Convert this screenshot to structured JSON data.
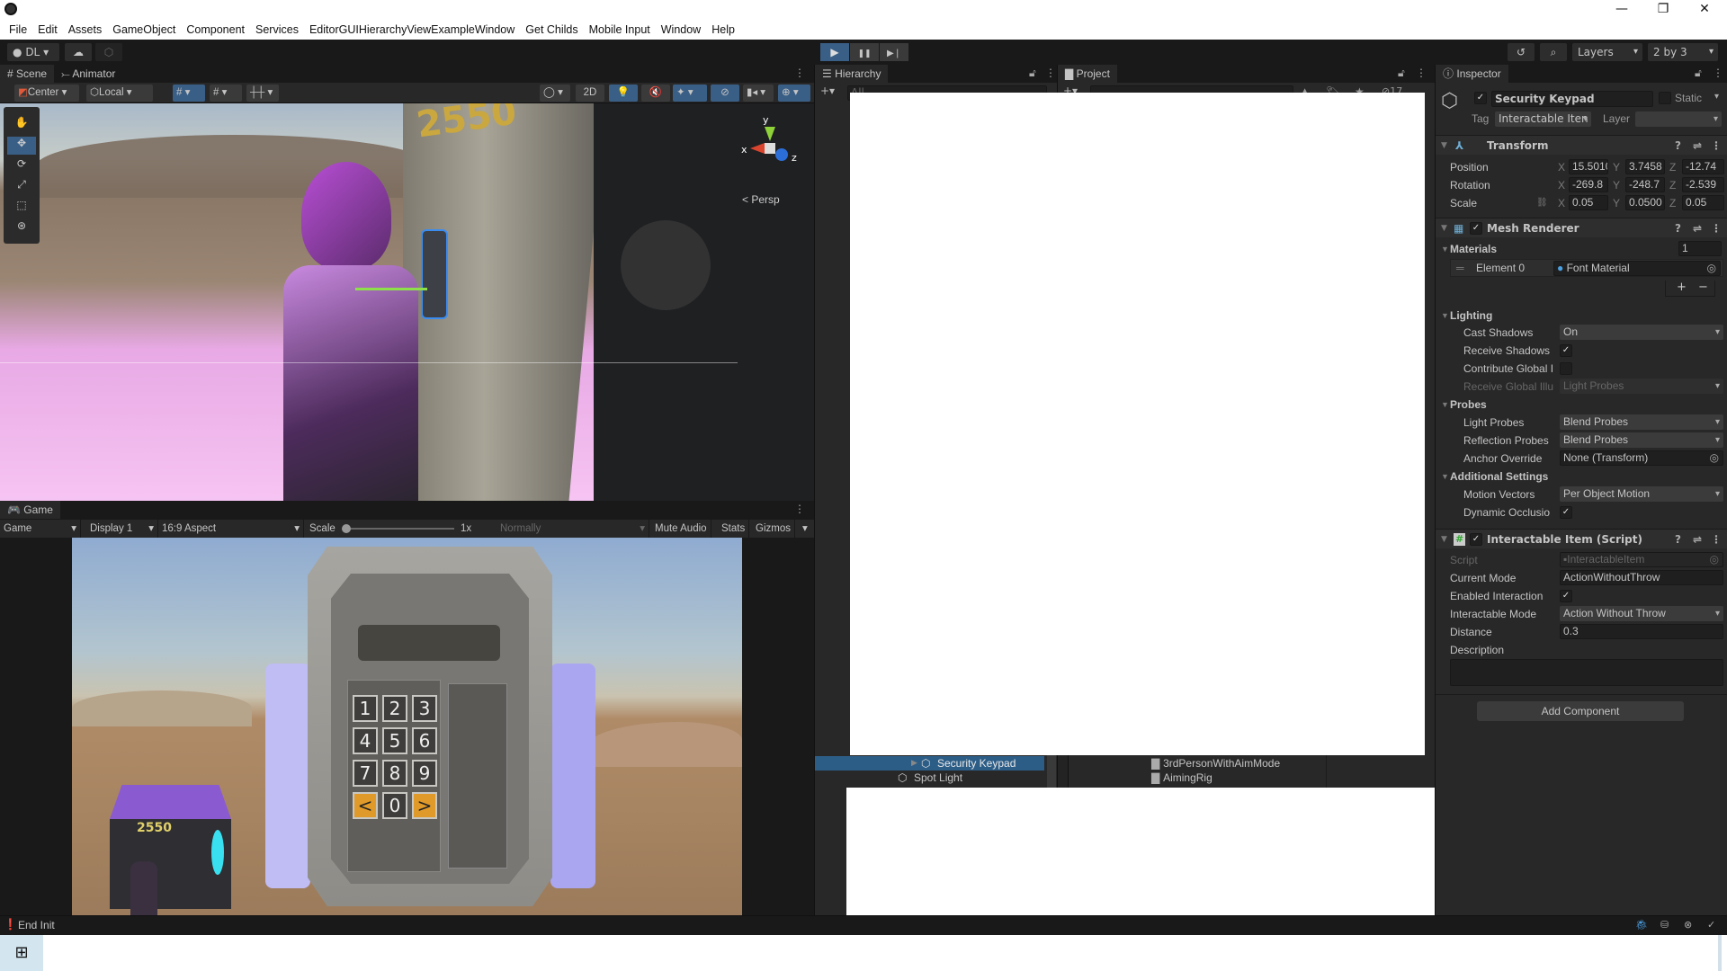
{
  "window": {
    "controls": {
      "minimize": "—",
      "maximize": "❐",
      "close": "✕"
    }
  },
  "menu": [
    "File",
    "Edit",
    "Assets",
    "GameObject",
    "Component",
    "Services",
    "EditorGUIHierarchyViewExampleWindow",
    "Get Childs",
    "Mobile Input",
    "Window",
    "Help"
  ],
  "toolbar": {
    "account": "DL",
    "cloud_icon": "cloud-icon",
    "collab_icon": "collab-icon",
    "play": "▶",
    "pause": "❚❚",
    "step": "▶❘",
    "history_icon": "history-icon",
    "search_icon": "search-icon",
    "layers": "Layers",
    "layout": "2 by 3"
  },
  "scene": {
    "tabs": [
      {
        "label": "Scene",
        "icon": "#"
      },
      {
        "label": "Animator",
        "icon": "⤚"
      }
    ],
    "toolbar": {
      "pivot": "Center",
      "space": "Local",
      "mode_2d": "2D"
    },
    "tools": [
      "hand",
      "move",
      "rotate",
      "scale",
      "rect",
      "transform"
    ],
    "gizmo": {
      "x": "x",
      "y": "y",
      "z": "z",
      "projection": "Persp"
    },
    "overlay_text": "2550"
  },
  "game": {
    "tab": "Game",
    "toolbar": {
      "view": "Game",
      "display": "Display 1",
      "aspect": "16:9 Aspect",
      "scale_label": "Scale",
      "scale_value": "1x",
      "play_mode": "Normally",
      "mute": "Mute Audio",
      "stats": "Stats",
      "gizmos": "Gizmos"
    },
    "keypad": {
      "keys": [
        "1",
        "2",
        "3",
        "4",
        "5",
        "6",
        "7",
        "8",
        "9",
        "<",
        "0",
        ">"
      ],
      "crate_label": "2550"
    }
  },
  "hierarchy": {
    "tab": "Hierarchy",
    "search_placeholder": "All",
    "items": [
      {
        "label": "Security Keypad",
        "selected": true
      },
      {
        "label": "Spot Light",
        "selected": false
      }
    ]
  },
  "project": {
    "tab": "Project",
    "search_placeholder": "",
    "hidden_count": "17",
    "items": [
      "3rdPersonWithAimMode",
      "AimingRig"
    ]
  },
  "inspector": {
    "tab": "Inspector",
    "object_name": "Security Keypad",
    "active": true,
    "static_label": "Static",
    "tag_label": "Tag",
    "tag_value": "Interactable Iten",
    "layer_label": "Layer",
    "layer_value": "",
    "transform": {
      "title": "Transform",
      "position": {
        "label": "Position",
        "x": "15.5010",
        "y": "3.7458",
        "z": "-12.74"
      },
      "rotation": {
        "label": "Rotation",
        "x": "-269.8",
        "y": "-248.7",
        "z": "-2.539"
      },
      "scale": {
        "label": "Scale",
        "x": "0.05",
        "y": "0.0500",
        "z": "0.05"
      }
    },
    "mesh_renderer": {
      "title": "Mesh Renderer",
      "enabled": true,
      "materials_label": "Materials",
      "materials_count": "1",
      "element_label": "Element 0",
      "element_value": "Font Material",
      "lighting_label": "Lighting",
      "cast_shadows_label": "Cast Shadows",
      "cast_shadows": "On",
      "receive_shadows_label": "Receive Shadows",
      "receive_shadows": true,
      "contribute_gi_label": "Contribute Global I",
      "contribute_gi": false,
      "receive_gi_label": "Receive Global Illu",
      "receive_gi": "Light Probes",
      "probes_label": "Probes",
      "light_probes_label": "Light Probes",
      "light_probes": "Blend Probes",
      "reflection_probes_label": "Reflection Probes",
      "reflection_probes": "Blend Probes",
      "anchor_override_label": "Anchor Override",
      "anchor_override": "None (Transform)",
      "additional_label": "Additional Settings",
      "motion_vectors_label": "Motion Vectors",
      "motion_vectors": "Per Object Motion",
      "dynamic_occlusion_label": "Dynamic Occlusio",
      "dynamic_occlusion": true
    },
    "script": {
      "title": "Interactable Item (Script)",
      "enabled": true,
      "script_label": "Script",
      "script_value": "InteractableItem",
      "current_mode_label": "Current Mode",
      "current_mode": "ActionWithoutThrow",
      "enabled_interaction_label": "Enabled Interaction",
      "enabled_interaction": true,
      "interactable_mode_label": "Interactable Mode",
      "interactable_mode": "Action Without Throw",
      "distance_label": "Distance",
      "distance": "0.3",
      "description_label": "Description",
      "description": ""
    },
    "add_component": "Add Component"
  },
  "status": {
    "message": "End Init"
  },
  "colors": {
    "accent": "#3a5f86",
    "panel": "#282828",
    "dark": "#191919",
    "orange_key": "#e09a2a",
    "keypad_side": "#b8b6f3"
  }
}
